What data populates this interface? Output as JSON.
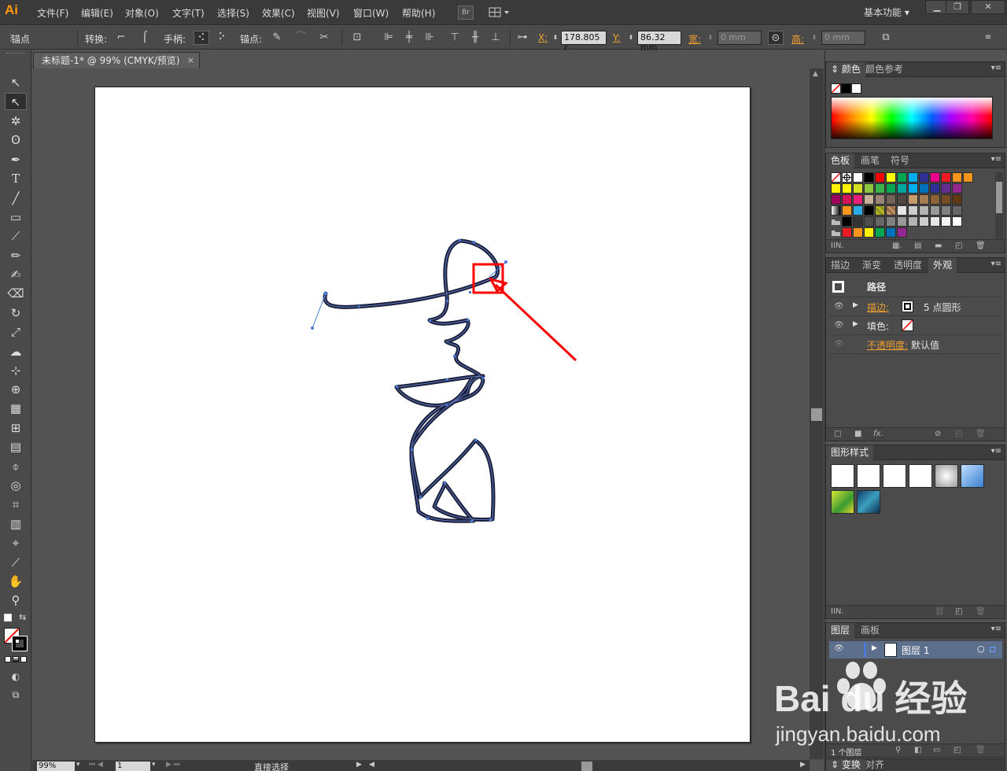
{
  "app": {
    "logo": "Ai"
  },
  "menu": {
    "items": [
      "文件(F)",
      "编辑(E)",
      "对象(O)",
      "文字(T)",
      "选择(S)",
      "效果(C)",
      "视图(V)",
      "窗口(W)",
      "帮助(H)"
    ],
    "bridge": "Br"
  },
  "workspace": {
    "label": "基本功能"
  },
  "control": {
    "tool_label": "锚点",
    "convert_label": "转换:",
    "handles_label": "手柄:",
    "anchors_label": "锚点:",
    "x_label": "X:",
    "x_value": "178.805 r",
    "y_label": "Y:",
    "y_value": "86.32 mm",
    "w_label": "宽:",
    "w_value": "0 mm",
    "h_label": "高:",
    "h_value": "0 mm"
  },
  "document": {
    "tab_title": "未标题-1* @ 99% (CMYK/预览)",
    "close": "×"
  },
  "status": {
    "zoom": "99%",
    "page": "1",
    "tool": "直接选择"
  },
  "panels": {
    "color": {
      "tabs": [
        "颜色",
        "颜色参考"
      ]
    },
    "swatches": {
      "tabs": [
        "色板",
        "画笔",
        "符号"
      ]
    },
    "appearance": {
      "tabs": [
        "描边",
        "渐变",
        "透明度",
        "外观"
      ],
      "title": "路径",
      "stroke_label": "描边:",
      "stroke_value": "5 点圆形",
      "fill_label": "填色:",
      "opacity_label": "不透明度:",
      "opacity_value": "默认值",
      "fx": "fx."
    },
    "graphic_styles": {
      "tabs": [
        "图形样式"
      ]
    },
    "layers": {
      "tabs": [
        "图层",
        "画板"
      ],
      "layer_name": "图层 1",
      "footer": "1 个图层"
    },
    "transform": {
      "tabs": [
        "变换",
        "对齐"
      ]
    }
  },
  "watermark": {
    "text": "Bai du 经验",
    "url": "jingyan.baidu.com"
  },
  "colors": {
    "accent": "#f0a030",
    "highlight": "#ff0000",
    "path": "#1b1f3a",
    "anchor": "#4a7ad8"
  }
}
